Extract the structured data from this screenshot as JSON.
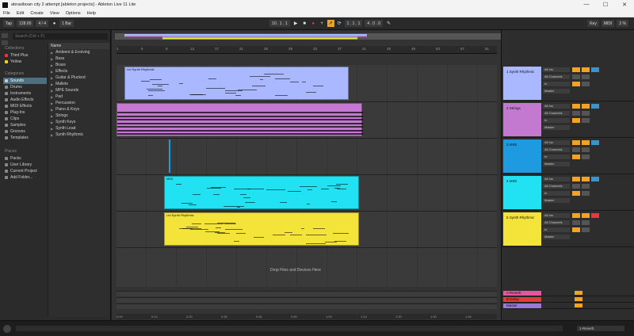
{
  "window": {
    "title": "abrasiboan city 2 attempt [ableton projects] - Ableton Live 11 Lite",
    "min": "—",
    "max": "☐",
    "close": "✕"
  },
  "menu": [
    "File",
    "Edit",
    "Create",
    "View",
    "Options",
    "Help"
  ],
  "transport": {
    "tap": "Tap",
    "tempo": "128.00",
    "meter": "4 / 4",
    "bars": "1 Bar",
    "position": "10 . 1 . 1",
    "loop_start": "1 . 1 . 1",
    "loop_len": "4 . 0 . 0",
    "key": "Key",
    "midi": "MIDI",
    "cpu": "2 %"
  },
  "browser": {
    "search_placeholder": "Search (Ctrl + F)",
    "collections_head": "Collections",
    "collections": [
      {
        "label": "Third Plus",
        "color": "#e23b3b"
      },
      {
        "label": "Yellow",
        "color": "#f2d029"
      }
    ],
    "categories_head": "Categories",
    "categories": [
      "Sounds",
      "Drums",
      "Instruments",
      "Audio Effects",
      "MIDI Effects",
      "Plug-Ins",
      "Clips",
      "Samples",
      "Grooves",
      "Templates"
    ],
    "places_head": "Places",
    "places": [
      "Packs",
      "User Library",
      "Current Project",
      "Add Folder..."
    ],
    "name_head": "Name",
    "names": [
      "Ambient & Evolving",
      "Bass",
      "Brass",
      "Effects",
      "Guitar & Plucked",
      "Mallets",
      "MPE Sounds",
      "Pad",
      "Percussion",
      "Piano & Keys",
      "Strings",
      "Synth Keys",
      "Synth Lead",
      "Synth Rhythmic"
    ]
  },
  "ruler": [
    "1",
    "5",
    "9",
    "13",
    "17",
    "21",
    "25",
    "29",
    "33",
    "37",
    "41",
    "45",
    "49",
    "53",
    "57",
    "61"
  ],
  "bottom_ruler": [
    "0:00",
    "0:10",
    "0:20",
    "0:30",
    "0:40",
    "0:50",
    "1:00",
    "1:10",
    "1:20",
    "1:30",
    "1:40"
  ],
  "arrangement": {
    "drop_text": "Drop Files and Devices Here"
  },
  "tracks": [
    {
      "name": "1 Synth Rhythmic",
      "color": "#a9b8ff"
    },
    {
      "name": "2 Strings",
      "color": "#c479d1"
    },
    {
      "name": "3 MIDI",
      "color": "#1e9be0"
    },
    {
      "name": "4 MIDI",
      "color": "#21e2f2"
    },
    {
      "name": "5 Synth Rhythmic",
      "color": "#f4e43a"
    }
  ],
  "returns": [
    {
      "name": "A Reverb",
      "color": "#e2599b"
    },
    {
      "name": "B Delay",
      "color": "#e23b3b"
    },
    {
      "name": "Master",
      "color": "#9a7ad8"
    }
  ],
  "track_ctrl": {
    "input": "All Ins",
    "channel": "All Channels",
    "out": "Master",
    "in_label": "In",
    "auto_label": "Auto",
    "off_label": "Off"
  },
  "status": {
    "right": "1-Reverb"
  },
  "clips": [
    {
      "name": "Ltd Synth Rhythmic",
      "color": "#a9b8ff"
    },
    {
      "name": "",
      "color": "#c479d1"
    },
    {
      "name": "MIDI",
      "color": "#21e2f2"
    },
    {
      "name": "Ltd Synth Rhythmic",
      "color": "#f4e43a"
    }
  ]
}
